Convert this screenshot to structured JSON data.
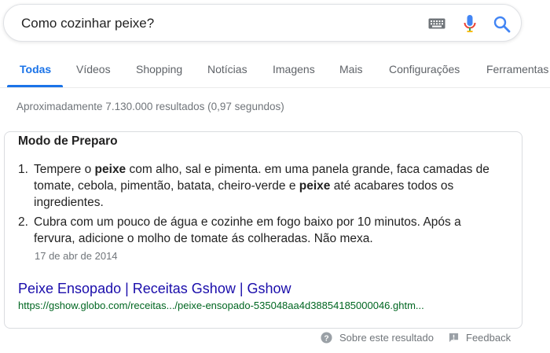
{
  "search": {
    "query": "Como cozinhar peixe?"
  },
  "tabs": [
    {
      "label": "Todas",
      "active": true
    },
    {
      "label": "Vídeos"
    },
    {
      "label": "Shopping"
    },
    {
      "label": "Notícias"
    },
    {
      "label": "Imagens"
    },
    {
      "label": "Mais"
    },
    {
      "label": "Configurações"
    },
    {
      "label": "Ferramentas"
    }
  ],
  "result_stats": "Aproximadamente 7.130.000 resultados (0,97 segundos)",
  "featured_snippet": {
    "title": "Modo de Preparo",
    "steps": [
      {
        "number": "1.",
        "parts": [
          "Tempere o ",
          "peixe",
          " com alho, sal e pimenta. em uma panela grande, faca camadas de tomate, cebola, pimentão, batata, cheiro-verde e ",
          "peixe",
          " até acabares todos os ingredientes."
        ]
      },
      {
        "number": "2.",
        "text": "Cubra com um pouco de água e cozinhe em fogo baixo por 10 minutos. Após a fervura, adicione o molho de tomate ás colheradas. Não mexa."
      }
    ],
    "date": "17 de abr de 2014",
    "link_title": "Peixe Ensopado | Receitas Gshow | Gshow",
    "url": "https://gshow.globo.com/receitas.../peixe-ensopado-535048aa4d38854185000046.ghtm..."
  },
  "footer": {
    "about_label": "Sobre este resultado",
    "feedback_label": "Feedback"
  },
  "colors": {
    "accent": "#1a73e8",
    "link": "#1a0dab",
    "url": "#006621",
    "muted": "#70757a"
  },
  "icons": [
    "keyboard-icon",
    "microphone-icon",
    "search-icon",
    "help-circle-icon",
    "feedback-icon"
  ]
}
